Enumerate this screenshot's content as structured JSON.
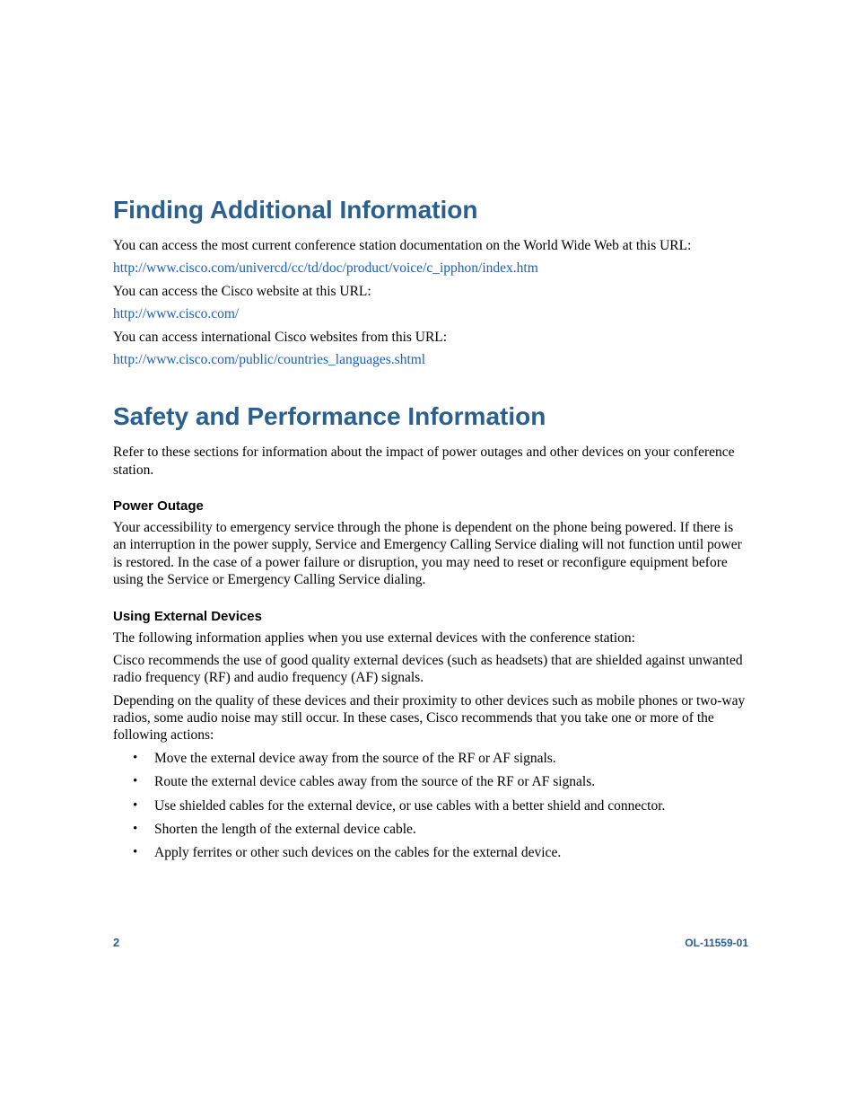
{
  "sections": {
    "finding": {
      "heading": "Finding Additional Information",
      "p1": "You can access the most current conference station documentation on the World Wide Web at this URL:",
      "link1": "http://www.cisco.com/univercd/cc/td/doc/product/voice/c_ipphon/index.htm",
      "p2": "You can access the Cisco website at this URL:",
      "link2": "http://www.cisco.com/",
      "p3": "You can access international Cisco websites from this URL:",
      "link3": "http://www.cisco.com/public/countries_languages.shtml"
    },
    "safety": {
      "heading": "Safety and Performance Information",
      "intro": "Refer to these sections for information about the impact of power outages and other devices on your conference station.",
      "power": {
        "heading": "Power Outage",
        "body": "Your accessibility to emergency service through the phone is dependent on the phone being powered. If there is an interruption in the power supply, Service and Emergency Calling Service dialing will not function until power is restored. In the case of a power failure or disruption, you may need to reset or reconfigure equipment before using the Service or Emergency Calling Service dialing."
      },
      "external": {
        "heading": "Using External Devices",
        "p1": "The following information applies when you use external devices with the conference station:",
        "p2": "Cisco recommends the use of good quality external devices (such as headsets) that are shielded against unwanted radio frequency (RF) and audio frequency (AF) signals.",
        "p3": "Depending on the quality of these devices and their proximity to other devices such as mobile phones or two-way radios, some audio noise may still occur. In these cases, Cisco recommends that you take one or more of the following actions:",
        "bullets": [
          "Move the external device away from the source of the RF or AF signals.",
          "Route the external device cables away from the source of the RF or AF signals.",
          "Use shielded cables for the external device, or use cables with a better shield and connector.",
          "Shorten the length of the external device cable.",
          "Apply ferrites or other such devices on the cables for the external device."
        ]
      }
    }
  },
  "footer": {
    "page": "2",
    "docid": "OL-11559-01"
  }
}
